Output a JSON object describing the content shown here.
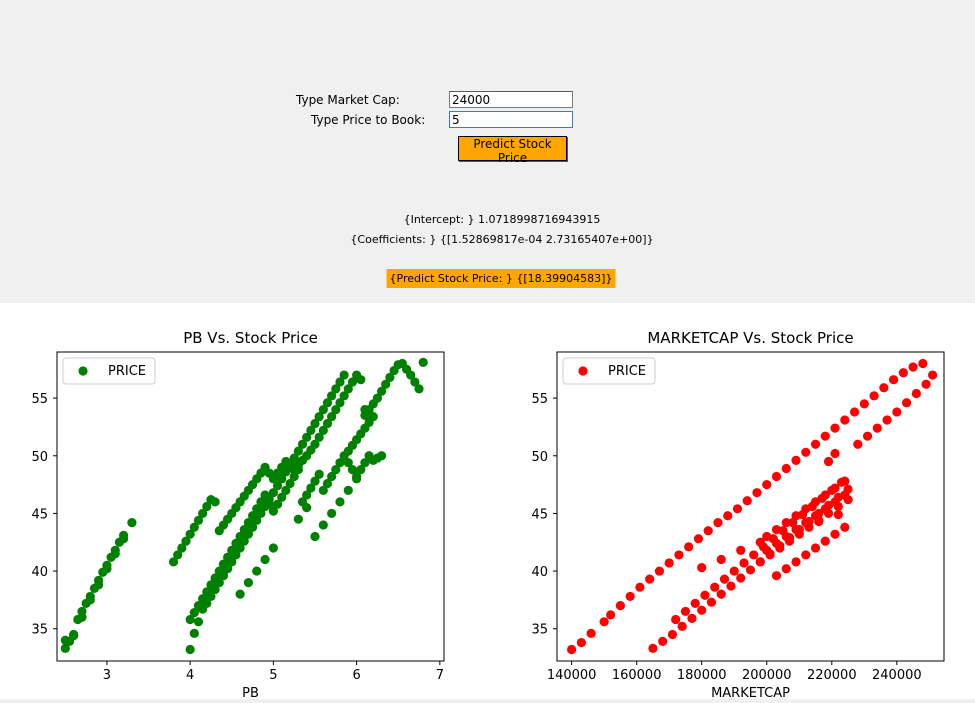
{
  "form": {
    "market_cap_label": "Type Market Cap:",
    "market_cap_value": "24000",
    "price_to_book_label": "Type Price to Book:",
    "price_to_book_value": "5",
    "predict_button_label": "Predict Stock Price"
  },
  "results": {
    "intercept_text": "{Intercept: } 1.0718998716943915",
    "coefficients_text": "{Coefficients: } {[1.52869817e-04 2.73165407e+00]}",
    "prediction_text": "{Predict Stock Price: } {[18.39904583]}"
  },
  "colors": {
    "accent": "#ffa500",
    "series_pb": "#008000",
    "series_marketcap": "#ff0000"
  },
  "chart_data": [
    {
      "type": "scatter",
      "title": "PB Vs. Stock Price",
      "xlabel": "PB",
      "ylabel": "",
      "xlim": [
        2.4,
        7.05
      ],
      "ylim": [
        32.2,
        59.0
      ],
      "xticks": [
        3,
        4,
        5,
        6,
        7
      ],
      "yticks": [
        35,
        40,
        45,
        50,
        55
      ],
      "grid": false,
      "legend_position": "top-left",
      "series": [
        {
          "name": "PRICE",
          "color": "#008000",
          "x": [
            2.5,
            2.55,
            2.6,
            2.65,
            2.7,
            2.75,
            2.8,
            2.85,
            2.9,
            2.95,
            3.0,
            3.05,
            3.1,
            3.15,
            3.2,
            3.3,
            2.5,
            2.6,
            2.7,
            2.8,
            2.9,
            3.0,
            3.1,
            3.2,
            3.8,
            3.85,
            3.9,
            3.95,
            4.0,
            4.05,
            4.1,
            4.15,
            4.2,
            4.25,
            4.3,
            4.35,
            4.4,
            4.45,
            4.5,
            4.55,
            4.6,
            4.65,
            4.7,
            4.75,
            4.8,
            4.85,
            4.9,
            4.95,
            5.0,
            5.05,
            5.1,
            5.15,
            5.2,
            5.25,
            5.3,
            5.35,
            5.4,
            5.45,
            5.5,
            5.55,
            5.6,
            5.65,
            5.7,
            5.75,
            5.8,
            5.85,
            5.9,
            5.95,
            6.0,
            6.05,
            6.1,
            6.1,
            6.15,
            6.2,
            6.25,
            6.3,
            6.35,
            6.4,
            6.45,
            6.5,
            6.55,
            6.6,
            6.65,
            6.7,
            6.75,
            6.8,
            4.0,
            4.05,
            4.1,
            4.15,
            4.2,
            4.25,
            4.3,
            4.35,
            4.4,
            4.45,
            4.5,
            4.55,
            4.6,
            4.65,
            4.7,
            4.75,
            4.8,
            4.85,
            4.9,
            4.95,
            5.0,
            5.05,
            5.1,
            5.15,
            5.2,
            5.25,
            5.3,
            5.35,
            5.4,
            5.45,
            5.5,
            5.55,
            5.6,
            5.65,
            5.7,
            5.75,
            5.8,
            5.85,
            5.9,
            5.95,
            6.0,
            6.05,
            6.1,
            6.15,
            6.2,
            4.0,
            4.05,
            4.1,
            4.15,
            4.2,
            4.25,
            4.3,
            4.35,
            4.4,
            4.45,
            4.5,
            4.55,
            4.6,
            4.65,
            4.7,
            4.75,
            4.8,
            4.85,
            4.9,
            4.95,
            5.0,
            5.05,
            5.1,
            5.15,
            5.2,
            5.25,
            5.3,
            5.35,
            5.4,
            5.45,
            5.5,
            5.55,
            5.6,
            5.65,
            5.7,
            5.75,
            5.8,
            5.85,
            5.9,
            5.95,
            6.0,
            6.05,
            6.1,
            6.15,
            6.2,
            6.25,
            6.3,
            4.6,
            4.7,
            4.8,
            4.9,
            5.0,
            5.5,
            5.6,
            5.7,
            5.8,
            5.9,
            6.0,
            5.3,
            5.4
          ],
          "y": [
            33.3,
            33.9,
            34.4,
            35.8,
            36.5,
            37.2,
            37.8,
            38.5,
            39.2,
            39.9,
            40.5,
            41.2,
            41.8,
            42.5,
            43.1,
            44.2,
            34.0,
            34.5,
            36.0,
            37.5,
            38.8,
            40.2,
            41.5,
            42.8,
            40.8,
            41.4,
            42.0,
            42.6,
            43.2,
            43.8,
            44.4,
            45.0,
            45.6,
            46.2,
            46.0,
            43.5,
            44.0,
            44.5,
            45.0,
            45.5,
            46.0,
            46.5,
            47.0,
            47.5,
            48.0,
            48.5,
            49.0,
            48.5,
            48.0,
            48.5,
            49.0,
            49.5,
            49.0,
            48.8,
            49.2,
            49.6,
            50.0,
            50.5,
            51.0,
            51.6,
            52.2,
            52.8,
            53.4,
            54.0,
            54.6,
            55.2,
            55.8,
            56.4,
            57.0,
            56.6,
            54.0,
            53.5,
            54.0,
            54.5,
            55.0,
            55.6,
            56.2,
            56.8,
            57.4,
            57.9,
            58.0,
            57.5,
            57.0,
            56.4,
            55.8,
            58.1,
            33.2,
            34.6,
            35.6,
            36.7,
            37.2,
            37.8,
            38.4,
            39.0,
            39.6,
            40.2,
            40.8,
            41.4,
            42.0,
            42.6,
            43.2,
            43.8,
            44.4,
            45.0,
            45.6,
            46.2,
            46.8,
            47.4,
            48.0,
            48.6,
            49.2,
            49.8,
            50.4,
            51.0,
            51.6,
            52.2,
            52.8,
            53.4,
            54.0,
            54.6,
            55.2,
            55.8,
            56.4,
            57.0,
            50.4,
            50.9,
            51.4,
            51.9,
            52.4,
            52.9,
            53.4,
            35.8,
            36.4,
            37.0,
            37.6,
            38.2,
            38.8,
            39.4,
            40.0,
            40.6,
            41.2,
            41.8,
            42.4,
            43.0,
            43.6,
            44.2,
            44.8,
            45.4,
            46.0,
            46.6,
            45.8,
            45.2,
            45.8,
            46.4,
            47.0,
            47.6,
            48.2,
            48.8,
            46.0,
            46.6,
            47.2,
            47.8,
            48.4,
            47.0,
            47.6,
            48.2,
            48.8,
            49.4,
            50.0,
            49.4,
            48.8,
            48.2,
            48.8,
            49.4,
            50.0,
            49.6,
            49.8,
            50.0,
            38.0,
            39.0,
            40.0,
            41.0,
            42.0,
            43.0,
            44.0,
            45.0,
            46.0,
            47.0,
            48.0,
            44.5,
            45.5
          ]
        }
      ]
    },
    {
      "type": "scatter",
      "title": "MARKETCAP Vs. Stock Price",
      "xlabel": "MARKETCAP",
      "ylabel": "",
      "xlim": [
        135500,
        254500
      ],
      "ylim": [
        32.2,
        59.0
      ],
      "xticks": [
        140000,
        160000,
        180000,
        200000,
        220000,
        240000
      ],
      "yticks": [
        35,
        40,
        45,
        50,
        55
      ],
      "grid": false,
      "legend_position": "top-left",
      "series": [
        {
          "name": "PRICE",
          "color": "#ff0000",
          "x": [
            140000,
            143000,
            146000,
            150000,
            152000,
            155000,
            158000,
            161000,
            164000,
            167000,
            170000,
            173000,
            176000,
            179000,
            182000,
            185000,
            188000,
            191000,
            194000,
            197000,
            200000,
            203000,
            206000,
            209000,
            212000,
            215000,
            218000,
            221000,
            224000,
            227000,
            230000,
            233000,
            236000,
            239000,
            242000,
            245000,
            248000,
            165000,
            168000,
            171000,
            174000,
            177000,
            180000,
            183000,
            186000,
            189000,
            192000,
            195000,
            198000,
            201000,
            204000,
            207000,
            210000,
            213000,
            216000,
            219000,
            222000,
            225000,
            228000,
            231000,
            234000,
            237000,
            240000,
            243000,
            246000,
            249000,
            251000,
            172000,
            175000,
            178000,
            181000,
            184000,
            187000,
            190000,
            193000,
            196000,
            199000,
            202000,
            205000,
            208000,
            211000,
            214000,
            217000,
            220000,
            223000,
            200000,
            203000,
            206000,
            209000,
            212000,
            215000,
            218000,
            221000,
            224000,
            200000,
            203000,
            206000,
            209000,
            212000,
            215000,
            218000,
            221000,
            224000,
            198000,
            201000,
            204000,
            207000,
            210000,
            213000,
            216000,
            219000,
            222000,
            225000,
            203000,
            206000,
            209000,
            212000,
            215000,
            218000,
            221000,
            224000,
            180000,
            186000,
            192000,
            198000,
            210000,
            216000,
            222000,
            219000,
            221000
          ],
          "y": [
            33.2,
            33.8,
            34.6,
            35.6,
            36.2,
            37.0,
            37.8,
            38.6,
            39.3,
            40.0,
            40.7,
            41.4,
            42.1,
            42.8,
            43.5,
            44.2,
            44.8,
            45.4,
            46.1,
            46.8,
            47.5,
            48.2,
            48.9,
            49.6,
            50.3,
            51.0,
            51.7,
            52.4,
            53.1,
            53.8,
            54.5,
            55.2,
            55.9,
            56.6,
            57.2,
            57.7,
            58.0,
            33.3,
            33.9,
            34.5,
            35.2,
            35.9,
            36.6,
            37.3,
            38.0,
            38.7,
            39.4,
            40.1,
            40.8,
            41.5,
            42.2,
            42.9,
            43.6,
            44.3,
            45.0,
            45.7,
            46.4,
            47.1,
            51.0,
            51.7,
            52.4,
            53.1,
            53.8,
            54.6,
            55.4,
            56.2,
            57.0,
            35.8,
            36.5,
            37.2,
            37.9,
            38.6,
            39.3,
            40.0,
            40.7,
            41.4,
            42.1,
            42.8,
            43.5,
            44.2,
            44.9,
            45.6,
            46.3,
            47.0,
            47.7,
            43.0,
            43.6,
            44.2,
            44.8,
            45.4,
            46.0,
            46.6,
            47.2,
            47.8,
            41.8,
            42.4,
            43.0,
            43.6,
            44.2,
            44.8,
            45.4,
            46.0,
            46.6,
            40.8,
            41.4,
            42.0,
            42.6,
            43.2,
            43.8,
            44.4,
            45.0,
            45.6,
            46.2,
            39.6,
            40.2,
            40.8,
            41.4,
            42.0,
            42.6,
            43.2,
            43.8,
            40.3,
            41.0,
            41.8,
            42.5,
            43.6,
            44.3,
            44.9,
            49.5,
            50.2
          ]
        }
      ]
    }
  ]
}
